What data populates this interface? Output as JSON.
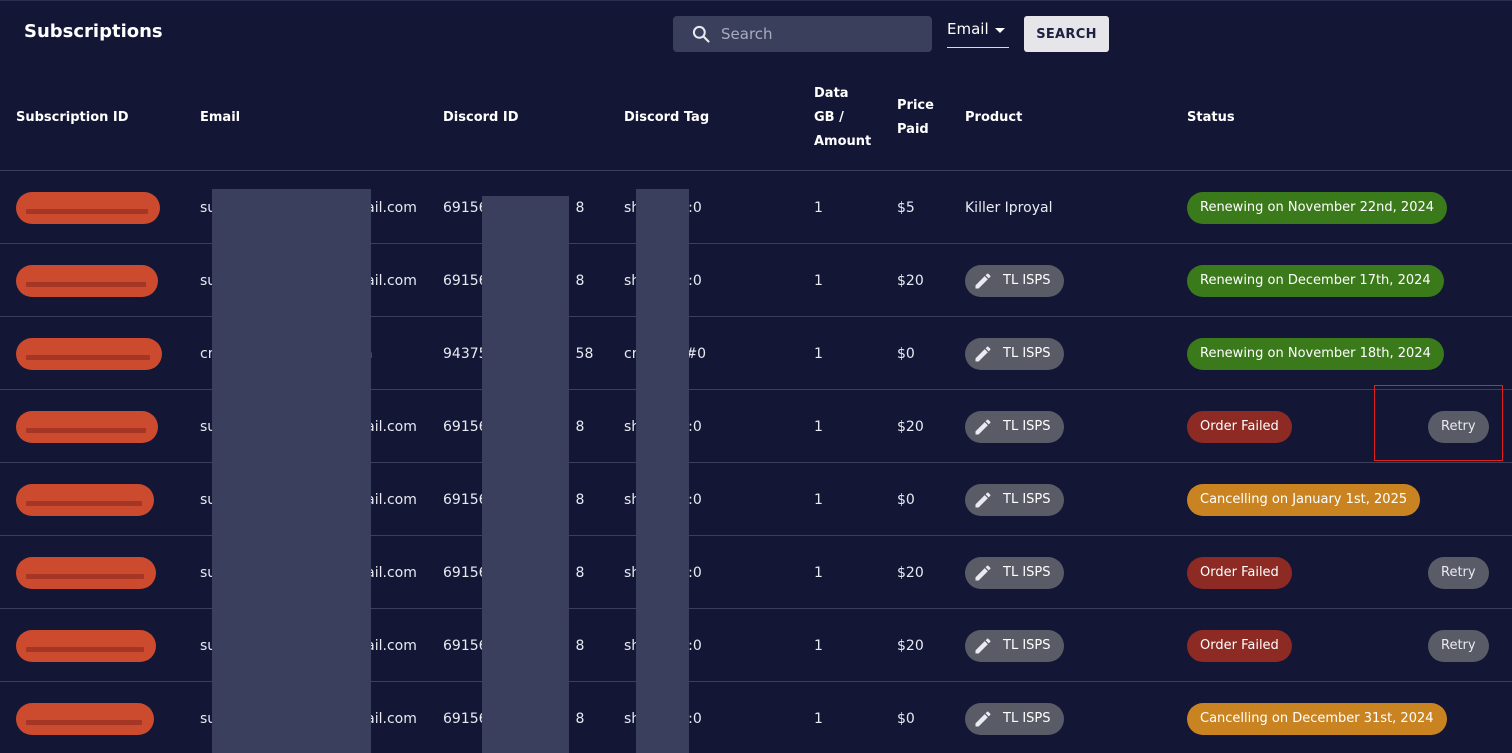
{
  "header": {
    "title": "Subscriptions",
    "search_placeholder": "Search",
    "search_field": "Email",
    "search_button": "SEARCH"
  },
  "table": {
    "columns": {
      "subscription_id": "Subscription ID",
      "email": "Email",
      "discord_id": "Discord ID",
      "discord_tag": "Discord Tag",
      "data_line1": "Data",
      "data_line2": "GB /",
      "data_line3": "Amount",
      "price_line1": "Price",
      "price_line2": "Paid",
      "product": "Product",
      "status": "Status"
    },
    "rows": [
      {
        "email_start": "su",
        "email_end": "ail.com",
        "discord_start": "69156",
        "discord_end": "8",
        "tag_start": "sh",
        "tag_end": ":0",
        "data": "1",
        "price": "$5",
        "product": "Killer Iproyal",
        "product_chip": false,
        "status": "Renewing on November 22nd, 2024",
        "status_color": "#3b7a1b",
        "retry": ""
      },
      {
        "email_start": "su",
        "email_end": "ail.com",
        "discord_start": "69156",
        "discord_end": "8",
        "tag_start": "sh",
        "tag_end": ":0",
        "data": "1",
        "price": "$20",
        "product": "TL ISPS",
        "product_chip": true,
        "status": "Renewing on December 17th, 2024",
        "status_color": "#3b7a1b",
        "retry": ""
      },
      {
        "email_start": "cr",
        "email_end": "n",
        "discord_start": "94375",
        "discord_end": "58",
        "tag_start": "cr",
        "tag_end": "#0",
        "data": "1",
        "price": "$0",
        "product": "TL ISPS",
        "product_chip": true,
        "status": "Renewing on November 18th, 2024",
        "status_color": "#3b7a1b",
        "retry": ""
      },
      {
        "email_start": "su",
        "email_end": "ail.com",
        "discord_start": "69156",
        "discord_end": "8",
        "tag_start": "sh",
        "tag_end": ":0",
        "data": "1",
        "price": "$20",
        "product": "TL ISPS",
        "product_chip": true,
        "status": "Order Failed",
        "status_color": "#8c2a23",
        "retry": "Retry"
      },
      {
        "email_start": "su",
        "email_end": "ail.com",
        "discord_start": "69156",
        "discord_end": "8",
        "tag_start": "sh",
        "tag_end": ":0",
        "data": "1",
        "price": "$0",
        "product": "TL ISPS",
        "product_chip": true,
        "status": "Cancelling on January 1st, 2025",
        "status_color": "#c98421",
        "retry": ""
      },
      {
        "email_start": "su",
        "email_end": "ail.com",
        "discord_start": "69156",
        "discord_end": "8",
        "tag_start": "sh",
        "tag_end": ":0",
        "data": "1",
        "price": "$20",
        "product": "TL ISPS",
        "product_chip": true,
        "status": "Order Failed",
        "status_color": "#8c2a23",
        "retry": "Retry"
      },
      {
        "email_start": "su",
        "email_end": "ail.com",
        "discord_start": "69156",
        "discord_end": "8",
        "tag_start": "sh",
        "tag_end": ":0",
        "data": "1",
        "price": "$20",
        "product": "TL ISPS",
        "product_chip": true,
        "status": "Order Failed",
        "status_color": "#8c2a23",
        "retry": "Retry"
      },
      {
        "email_start": "su",
        "email_end": "ail.com",
        "discord_start": "69156",
        "discord_end": "8",
        "tag_start": "sh",
        "tag_end": ":0",
        "data": "1",
        "price": "$0",
        "product": "TL ISPS",
        "product_chip": true,
        "status": "Cancelling on December 31st, 2024",
        "status_color": "#c98421",
        "retry": ""
      }
    ]
  },
  "colors": {
    "background": "#131735",
    "subscription_pill": "#cc4a2d",
    "status_green": "#3b7a1b",
    "status_red": "#8c2a23",
    "status_orange": "#c98421",
    "chip_gray": "#595c66"
  },
  "icons": {
    "search": "search-icon",
    "dropdown": "caret-down-icon",
    "product": "pencil-icon"
  }
}
